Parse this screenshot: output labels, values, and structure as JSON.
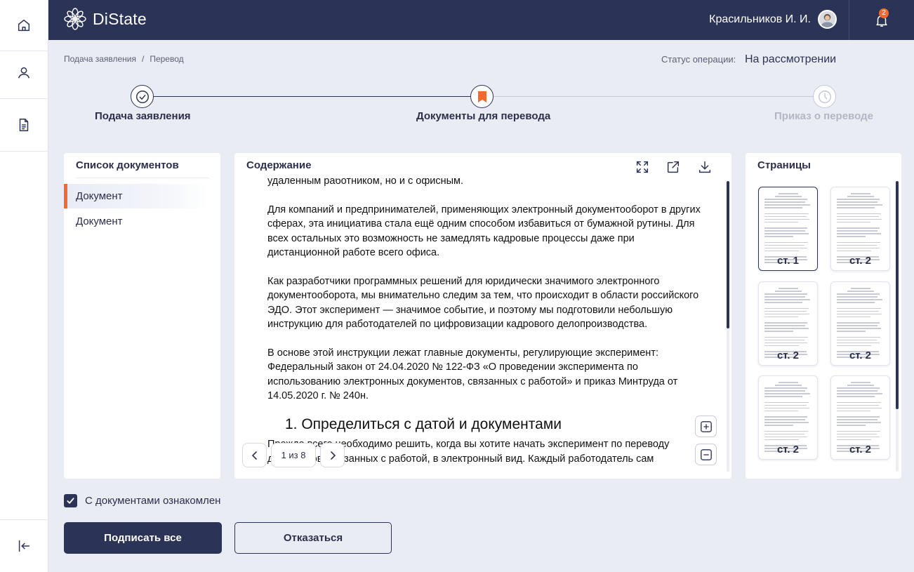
{
  "app": {
    "name": "DiState"
  },
  "header": {
    "user_name": "Красильников И. И.",
    "notifications_count": "2"
  },
  "rail": {
    "icons": [
      "home-icon",
      "user-icon",
      "document-icon",
      "logout-icon"
    ]
  },
  "breadcrumbs": [
    "Подача заявления",
    "/",
    "Перевод"
  ],
  "status": {
    "label": "Статус операции:",
    "value": "На рассмотрении"
  },
  "stepper": {
    "steps": [
      {
        "label": "Подача заявления",
        "state": "done"
      },
      {
        "label": "Документы для перевода",
        "state": "current"
      },
      {
        "label": "Приказ о переводе",
        "state": "pending"
      }
    ]
  },
  "documents_panel": {
    "title": "Список документов",
    "items": [
      {
        "label": "Документ",
        "active": true
      },
      {
        "label": "Документ",
        "active": false
      }
    ]
  },
  "viewer": {
    "title": "Содержание",
    "paragraphs": [
      "удаленным работником, но и с офисным.",
      "Для компаний и предпринимателей, применяющих электронный документооборот в других сферах, эта инициатива стала ещё одним способом избавиться от бумажной рутины. Для всех остальных это возможность не замедлять кадровые процессы даже при дистанционной работе всего офиса.",
      "Как разработчики программных решений для юридически значимого электронного документооборота, мы внимательно следим за тем, что происходит в области российского ЭДО. Этот эксперимент — значимое событие, и поэтому мы подготовили небольшую инструкцию для работодателей по цифровизации кадрового делопроизводства.",
      "В основе этой инструкции лежат главные документы, регулирующие эксперимент: Федеральный закон от 24.04.2020 № 122-ФЗ «О проведении эксперимента по использованию электронных документов, связанных с работой» и приказ Минтруда от 14.05.2020 г. № 240н."
    ],
    "heading": "1. Определиться с датой и документами",
    "tail_paragraph": "Прежде всего необходимо решить, когда вы хотите начать эксперимент по переводу документов, связанных с работой, в электронный вид. Каждый работодатель сам",
    "pager": {
      "text": "1 из 8"
    },
    "scroll_fraction": 0.5
  },
  "pages_panel": {
    "title": "Страницы",
    "thumbs": [
      "ст. 1",
      "ст. 2",
      "ст. 2",
      "ст. 2",
      "ст. 2",
      "ст. 2"
    ],
    "selected_index": 0
  },
  "agreement": {
    "label": "С документами ознакомлен",
    "checked": true
  },
  "actions": {
    "sign_all": "Подписать все",
    "decline": "Отказаться"
  },
  "colors": {
    "navy": "#2b3356",
    "accent": "#f26a2e",
    "background": "#e9ecf3"
  }
}
